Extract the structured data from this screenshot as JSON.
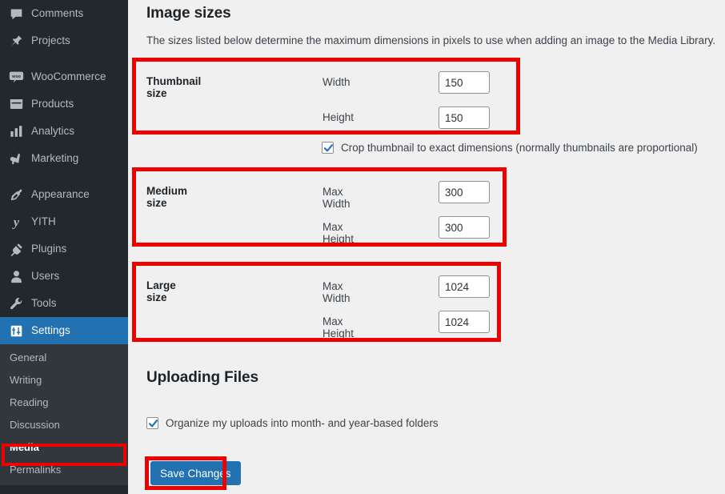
{
  "sidebar": {
    "items": [
      {
        "label": "Comments",
        "icon": "comments-icon",
        "gap_before": false,
        "current": false
      },
      {
        "label": "Projects",
        "icon": "pin-icon",
        "gap_before": false,
        "current": false
      },
      {
        "label": "WooCommerce",
        "icon": "woo-icon",
        "gap_before": true,
        "current": false
      },
      {
        "label": "Products",
        "icon": "products-icon",
        "gap_before": false,
        "current": false
      },
      {
        "label": "Analytics",
        "icon": "analytics-icon",
        "gap_before": false,
        "current": false
      },
      {
        "label": "Marketing",
        "icon": "megaphone-icon",
        "gap_before": false,
        "current": false
      },
      {
        "label": "Appearance",
        "icon": "appearance-icon",
        "gap_before": true,
        "current": false
      },
      {
        "label": "YITH",
        "icon": "yith-icon",
        "gap_before": false,
        "current": false
      },
      {
        "label": "Plugins",
        "icon": "plugins-icon",
        "gap_before": false,
        "current": false
      },
      {
        "label": "Users",
        "icon": "users-icon",
        "gap_before": false,
        "current": false
      },
      {
        "label": "Tools",
        "icon": "tools-icon",
        "gap_before": false,
        "current": false
      },
      {
        "label": "Settings",
        "icon": "settings-icon",
        "gap_before": false,
        "current": true
      }
    ],
    "submenu": [
      {
        "label": "General",
        "active": false
      },
      {
        "label": "Writing",
        "active": false
      },
      {
        "label": "Reading",
        "active": false
      },
      {
        "label": "Discussion",
        "active": false
      },
      {
        "label": "Media",
        "active": true
      },
      {
        "label": "Permalinks",
        "active": false
      }
    ]
  },
  "main": {
    "image_sizes_heading": "Image sizes",
    "image_sizes_description": "The sizes listed below determine the maximum dimensions in pixels to use when adding an image to the Media Library.",
    "sizes": [
      {
        "name": "Thumbnail size",
        "fields": [
          {
            "label": "Width",
            "value": "150"
          },
          {
            "label": "Height",
            "value": "150"
          }
        ]
      },
      {
        "name": "Medium size",
        "fields": [
          {
            "label": "Max Width",
            "value": "300"
          },
          {
            "label": "Max Height",
            "value": "300"
          }
        ]
      },
      {
        "name": "Large size",
        "fields": [
          {
            "label": "Max Width",
            "value": "1024"
          },
          {
            "label": "Max Height",
            "value": "1024"
          }
        ]
      }
    ],
    "crop_checkbox": {
      "label": "Crop thumbnail to exact dimensions (normally thumbnails are proportional)",
      "checked": true
    },
    "uploading_files_heading": "Uploading Files",
    "organize_checkbox": {
      "label": "Organize my uploads into month- and year-based folders",
      "checked": true
    },
    "save_button_label": "Save Changes"
  },
  "colors": {
    "sidebar_bg": "#23282d",
    "submenu_bg": "#32373c",
    "accent_blue": "#2271b1",
    "annotation_red": "#ee0000",
    "content_bg": "#f0f0f1"
  }
}
